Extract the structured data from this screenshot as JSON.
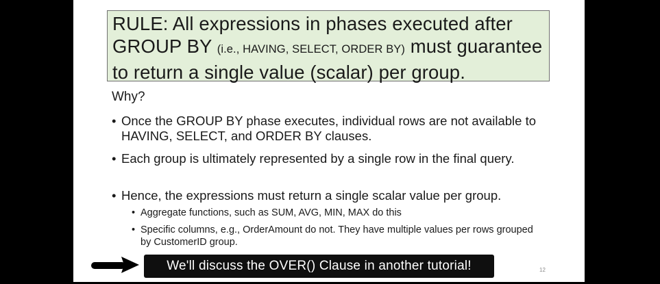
{
  "rule": {
    "part1": "RULE: All expressions in phases executed after GROUP BY ",
    "part2": "(i.e., HAVING, SELECT, ORDER BY)",
    "part3": " must guarantee to return a single value (scalar) per group."
  },
  "why_heading": "Why?",
  "bullets": [
    {
      "marker": "•",
      "text": "Once the GROUP BY phase executes, individual rows are not available to HAVING, SELECT, and ORDER BY clauses."
    },
    {
      "marker": "•",
      "text": "Each group is ultimately represented by a single row in the final query."
    },
    {
      "marker": "•",
      "text": "Hence, the expressions must return a single scalar value per group."
    }
  ],
  "sub_bullets": [
    {
      "marker": "•",
      "text": "Aggregate functions, such as SUM, AVG, MIN, MAX do this"
    },
    {
      "marker": "•",
      "text": "Specific columns, e.g., OrderAmount do not. They have multiple values per rows grouped by CustomerID group."
    }
  ],
  "banner": {
    "text": "We'll discuss the OVER() Clause in another tutorial!"
  },
  "page_number": "12",
  "colors": {
    "rule_box_bg": "#e3efd9",
    "banner_bg": "#0f0f0f",
    "letterbox": "#000000"
  },
  "icons": {
    "arrow": "arrow-right-icon"
  }
}
